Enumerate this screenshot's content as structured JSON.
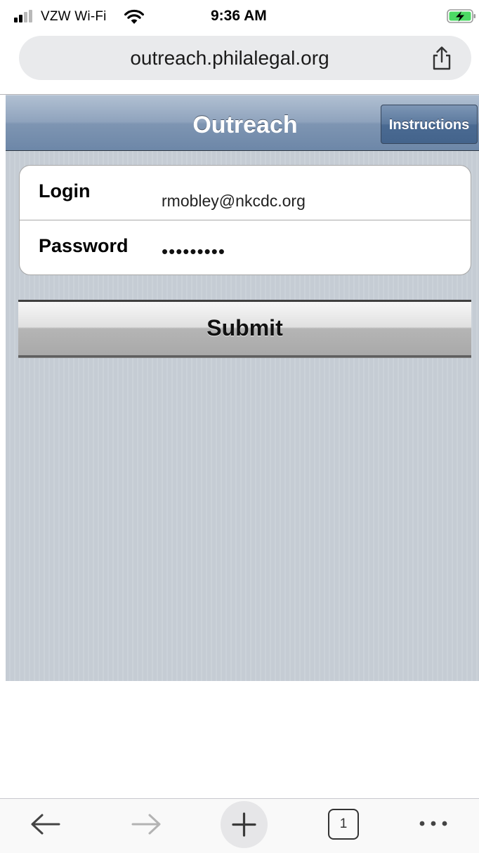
{
  "status_bar": {
    "carrier": "VZW Wi-Fi",
    "time": "9:36 AM",
    "icons": [
      "signal-icon",
      "wifi-icon",
      "battery-charging-icon"
    ]
  },
  "browser": {
    "url": "outreach.philalegal.org",
    "share_icon": "share-icon",
    "bottom_toolbar": {
      "back_icon": "arrow-left-icon",
      "forward_icon": "arrow-right-icon",
      "new_tab_icon": "plus-icon",
      "tab_count": "1",
      "more_icon": "ellipsis-icon"
    }
  },
  "app": {
    "title": "Outreach",
    "instructions_label": "Instructions",
    "form": {
      "login_label": "Login",
      "login_value": "rmobley@nkcdc.org",
      "password_label": "Password",
      "password_value": "•••••••••"
    },
    "submit_label": "Submit"
  },
  "colors": {
    "toolbar_blue": "#7e95b2",
    "page_background": "#c5ccd4",
    "instructions_button": "#4a6a92"
  }
}
